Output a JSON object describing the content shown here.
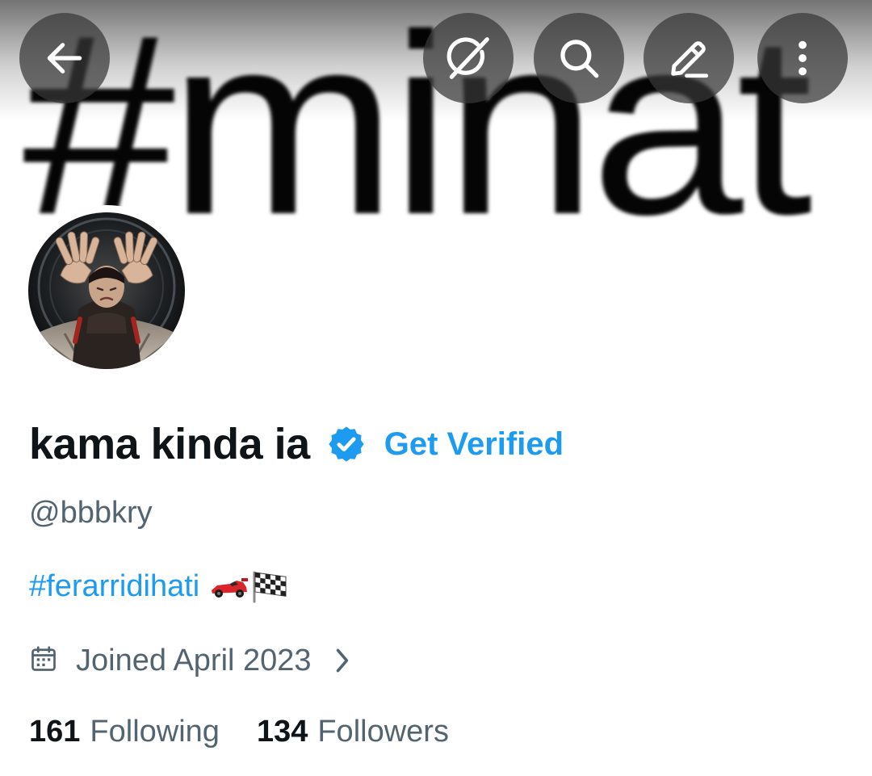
{
  "banner": {
    "text": "#minat"
  },
  "topbar": {
    "back_icon": "arrow-left-icon",
    "grok_icon": "grok-icon",
    "search_icon": "search-icon",
    "edit_icon": "pencil-icon",
    "more_icon": "more-vertical-icon"
  },
  "profile": {
    "display_name": "kama kinda ia",
    "verified_icon": "verified-badge-icon",
    "get_verified_label": "Get Verified",
    "handle": "@bbbkry",
    "bio": {
      "hashtag": "#ferarridihati",
      "emojis": [
        "racing-car",
        "checkered-flag"
      ]
    },
    "joined": {
      "icon": "calendar-icon",
      "text": "Joined April 2023",
      "chevron_icon": "chevron-right-icon"
    },
    "stats": {
      "following_count": "161",
      "following_label": "Following",
      "followers_count": "134",
      "followers_label": "Followers"
    }
  },
  "colors": {
    "accent": "#1d9bf0",
    "text_primary": "#0f1419",
    "text_secondary": "#536471",
    "button_overlay": "#373737"
  }
}
